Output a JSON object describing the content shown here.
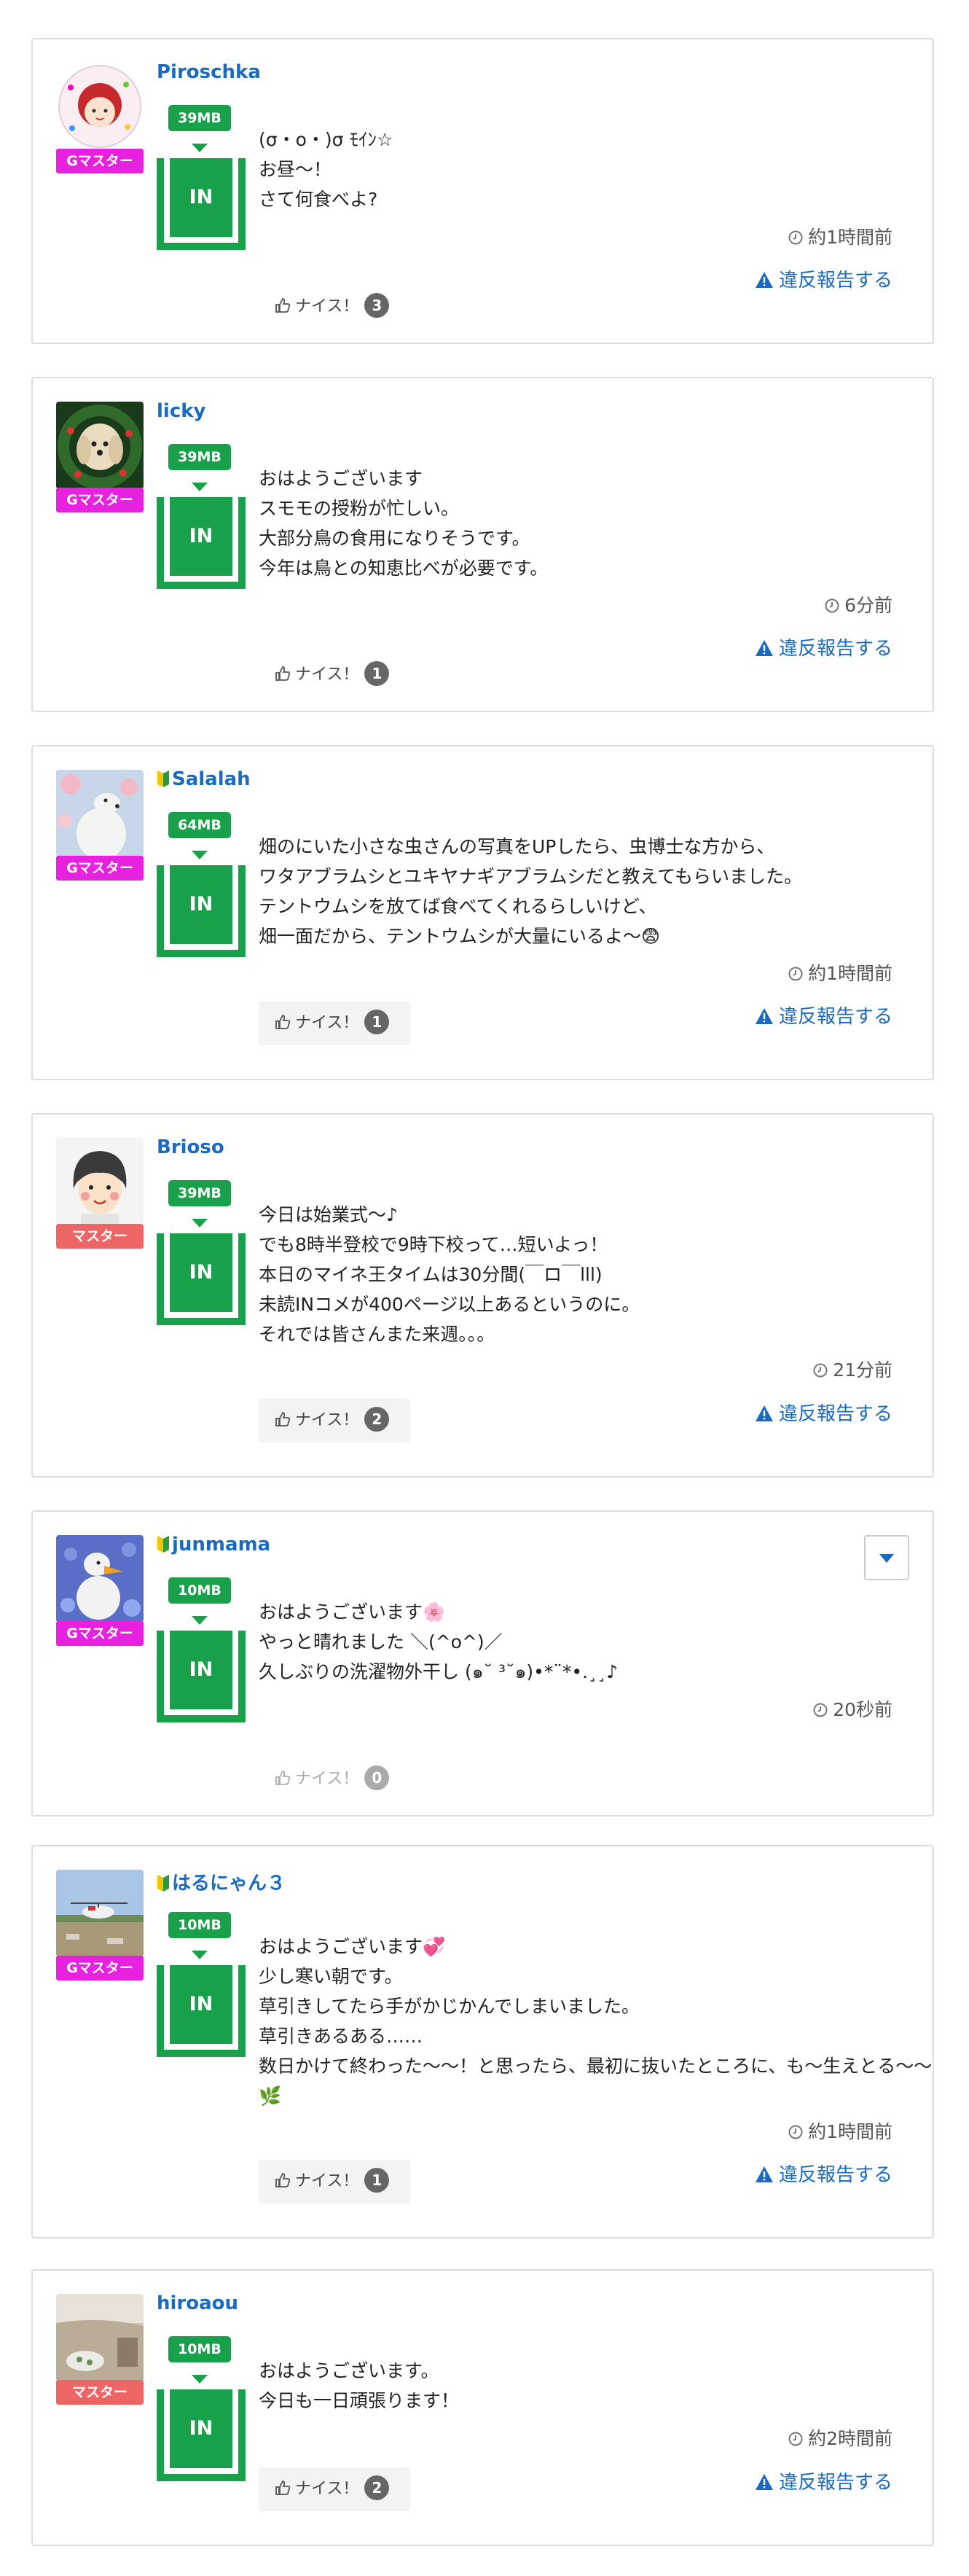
{
  "posts": [
    {
      "name": "Piroschka",
      "beginner": false,
      "rank": "Gマスター",
      "mb": "39MB",
      "in_label": "IN",
      "lines": [
        "(σ・o・)σ ﾓｲﾝ☆",
        "お昼〜！",
        "さて何食べよ?"
      ],
      "time": "約1時間前",
      "report": "違反報告する",
      "nice_label": "ナイス！",
      "nice_count": "3",
      "dropdown": false
    },
    {
      "name": "licky",
      "beginner": false,
      "rank": "Gマスター",
      "mb": "39MB",
      "in_label": "IN",
      "lines": [
        "おはようございます",
        "スモモの授粉が忙しい。",
        "大部分鳥の食用になりそうです。",
        "今年は鳥との知恵比べが必要です。"
      ],
      "time": "6分前",
      "report": "違反報告する",
      "nice_label": "ナイス！",
      "nice_count": "1",
      "dropdown": false
    },
    {
      "name": "Salalah",
      "beginner": true,
      "rank": "Gマスター",
      "mb": "64MB",
      "in_label": "IN",
      "lines": [
        "畑のにいた小さな虫さんの写真をUPしたら、虫博士な方から、",
        "ワタアブラムシとユキヤナギアブラムシだと教えてもらいました。",
        "テントウムシを放てば食べてくれるらしいけど、",
        "畑一面だから、テントウムシが大量にいるよ〜😨"
      ],
      "time": "約1時間前",
      "report": "違反報告する",
      "nice_label": "ナイス！",
      "nice_count": "1",
      "dropdown": false
    },
    {
      "name": "Brioso",
      "beginner": false,
      "rank": "マスター",
      "mb": "39MB",
      "in_label": "IN",
      "lines": [
        "今日は始業式〜♪",
        "でも8時半登校で9時下校って…短いよっ！",
        "本日のマイネ王タイムは30分間(￣ロ￣lll)",
        "未読INコメが400ページ以上あるというのに。",
        "それでは皆さんまた来週。。。"
      ],
      "time": "21分前",
      "report": "違反報告する",
      "nice_label": "ナイス！",
      "nice_count": "2",
      "dropdown": false
    },
    {
      "name": "junmama",
      "beginner": true,
      "rank": "Gマスター",
      "mb": "10MB",
      "in_label": "IN",
      "lines": [
        "おはようございます🌸",
        "やっと晴れました ＼(^o^)／",
        "久しぶりの洗濯物外干し (๑˘ ³˘๑)•*¨*•.¸¸♪"
      ],
      "time": "20秒前",
      "report": "",
      "nice_label": "ナイス！",
      "nice_count": "0",
      "dropdown": true
    },
    {
      "name": "はるにゃん３",
      "beginner": true,
      "rank": "Gマスター",
      "mb": "10MB",
      "in_label": "IN",
      "lines": [
        "おはようございます💞",
        "少し寒い朝です。",
        "草引きしてたら手がかじかんでしまいました。",
        "草引きあるある……",
        "数日かけて終わった〜〜！と思ったら、最初に抜いたところに、も〜生えとる〜〜🌿"
      ],
      "time": "約1時間前",
      "report": "違反報告する",
      "nice_label": "ナイス！",
      "nice_count": "1",
      "dropdown": false
    },
    {
      "name": "hiroaou",
      "beginner": false,
      "rank": "マスター",
      "mb": "10MB",
      "in_label": "IN",
      "lines": [
        "おはようございます。",
        "今日も一日頑張ります！"
      ],
      "time": "約2時間前",
      "report": "違反報告する",
      "nice_label": "ナイス！",
      "nice_count": "2",
      "dropdown": false
    }
  ]
}
